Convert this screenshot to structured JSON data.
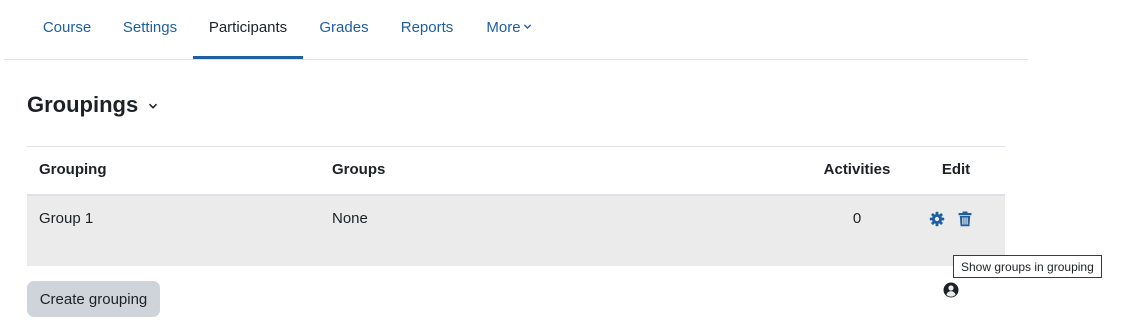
{
  "nav": {
    "tabs": [
      {
        "label": "Course"
      },
      {
        "label": "Settings"
      },
      {
        "label": "Participants",
        "active": true
      },
      {
        "label": "Grades"
      },
      {
        "label": "Reports"
      },
      {
        "label": "More"
      }
    ]
  },
  "heading": {
    "title": "Groupings",
    "icon": "chevron-down-icon"
  },
  "table": {
    "headers": {
      "grouping": "Grouping",
      "groups": "Groups",
      "activities": "Activities",
      "edit": "Edit"
    },
    "rows": [
      {
        "grouping": "Group 1",
        "groups": "None",
        "activities": "0",
        "actions": [
          "gear-icon",
          "trash-icon",
          "user-circle-icon"
        ]
      }
    ]
  },
  "tooltip": "Show groups in grouping",
  "create_button": "Create grouping",
  "colors": {
    "link": "#1f5fa0",
    "active_underline": "#1f5fa0",
    "row_background": "#ebebeb",
    "button_background": "#ced4da",
    "icon": "#1f5fa0",
    "icon_dark": "#1d2125"
  }
}
